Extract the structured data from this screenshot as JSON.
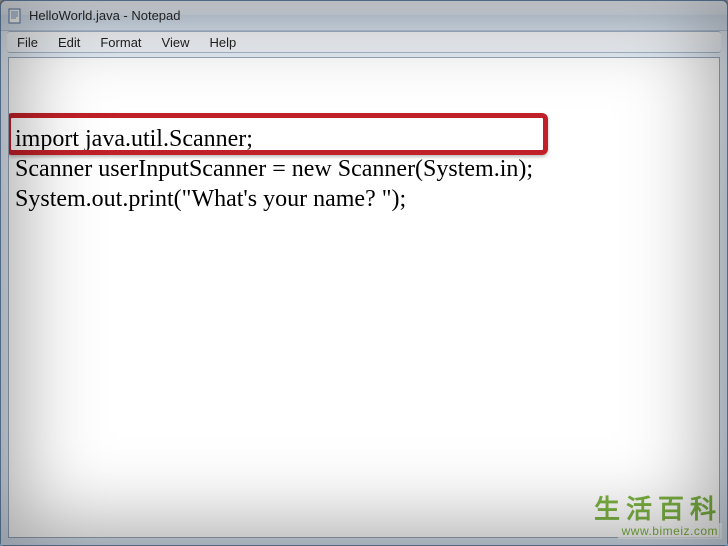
{
  "window": {
    "title": "HelloWorld.java - Notepad"
  },
  "menubar": {
    "items": [
      "File",
      "Edit",
      "Format",
      "View",
      "Help"
    ]
  },
  "code": {
    "line1": "import java.util.Scanner;",
    "line2": "Scanner userInputScanner = new Scanner(System.in);",
    "line3": "System.out.print(\"What's your name? \");"
  },
  "watermark": {
    "title": "生活百科",
    "url": "www.bimeiz.com"
  }
}
